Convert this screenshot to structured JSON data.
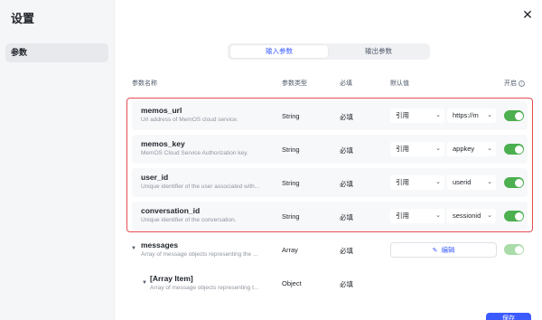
{
  "sidebar": {
    "title": "设置",
    "items": [
      {
        "label": "参数"
      }
    ]
  },
  "icons": {
    "close": "close-icon",
    "edit": "edit-icon",
    "chevron": "chevron-down-icon",
    "info": "info-icon",
    "caret": "caret-down-icon"
  },
  "tabs": [
    {
      "label": "输入参数",
      "active": true
    },
    {
      "label": "输出参数",
      "active": false
    }
  ],
  "table": {
    "headers": {
      "name": "参数名称",
      "type": "参数类型",
      "required": "必填",
      "default": "默认值",
      "enabled": "开启"
    },
    "rows": [
      {
        "name": "memos_url",
        "description": "Url address of MemOS cloud service.",
        "type": "String",
        "required": "必填",
        "ref": "引用",
        "value": "https://m",
        "enabled": true
      },
      {
        "name": "memos_key",
        "description": "MemOS Cloud Service Authorization key.",
        "type": "String",
        "required": "必填",
        "ref": "引用",
        "value": "appkey",
        "enabled": true
      },
      {
        "name": "user_id",
        "description": "Unique identifier of the user associated with...",
        "type": "String",
        "required": "必填",
        "ref": "引用",
        "value": "userid",
        "enabled": true
      },
      {
        "name": "conversation_id",
        "description": "Unique identifier of the conversation.",
        "type": "String",
        "required": "必填",
        "ref": "引用",
        "value": "sessionid",
        "enabled": true
      }
    ],
    "messages": {
      "name": "messages",
      "description": "Array of message objects representing the ...",
      "type": "Array",
      "required": "必填",
      "edit_label": "编辑",
      "enabled": true
    },
    "array_item": {
      "name": "[Array Item]",
      "description": "Array of message objects representing t...",
      "type": "Object",
      "required": "必填"
    }
  },
  "footer": {
    "save_label": "保存"
  },
  "colors": {
    "accent": "#3b5bff",
    "toggle_on": "#4caf50",
    "highlight": "#e54d52"
  }
}
